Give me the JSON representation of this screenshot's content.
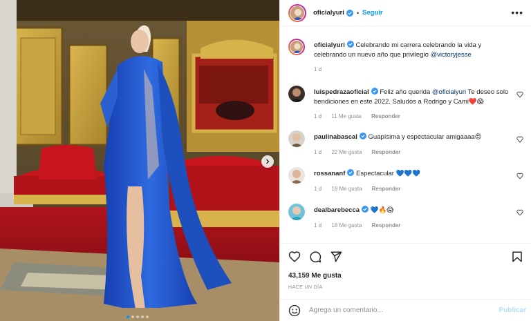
{
  "post": {
    "username": "oficialyuri",
    "follow_label": "Seguir",
    "separator": "•",
    "more_label": "•••"
  },
  "caption": {
    "username": "oficialyuri",
    "text": "Celebrando mi carrera celebrando la vida y celebrando un nuevo año que privilegio",
    "mention": "@victoryjesse",
    "time": "1 d"
  },
  "comments": [
    {
      "username": "luispedrazaoficial",
      "text_a": "Feliz año querida",
      "mention": "@oficialyuri",
      "text_b": "Te deseo solo bendiciones en este 2022. Saludos a Rodrigo y Cami❤️😱",
      "time": "1 d",
      "likes": "11 Me gusta",
      "reply": "Responder"
    },
    {
      "username": "paulinabascal",
      "text": "Guapísima y espectacular amigaaaa😍",
      "time": "1 d",
      "likes": "22 Me gusta",
      "reply": "Responder"
    },
    {
      "username": "rossananf",
      "text": "Espectacular 💙💙💙",
      "time": "1 d",
      "likes": "18 Me gusta",
      "reply": "Responder"
    },
    {
      "username": "dealbarebecca",
      "text": "💙🔥😱",
      "time": "1 d",
      "likes": "18 Me gusta",
      "reply": "Responder"
    }
  ],
  "stats": {
    "likes": "43,159 Me gusta",
    "ago": "HACE UN DÍA"
  },
  "composer": {
    "placeholder": "Agrega un comentario...",
    "publish_label": "Publicar"
  },
  "carousel": {
    "slides": 5,
    "active_index": 0
  },
  "colors": {
    "accent": "#0095f6",
    "verified": "#3897f0",
    "publish_disabled": "#b2dffc",
    "dress": "#1e56c9"
  },
  "icons": {
    "header_more": "more-icon",
    "verified": "verified-badge-icon",
    "like": "heart-icon",
    "comment": "comment-icon",
    "share": "send-icon",
    "save": "bookmark-icon",
    "emoji": "emoji-icon",
    "next": "chevron-right-icon"
  }
}
